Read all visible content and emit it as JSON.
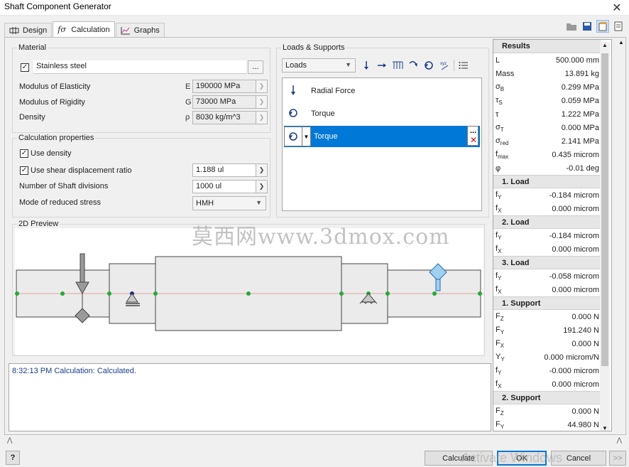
{
  "window": {
    "title": "Shaft Component Generator",
    "close": "✕"
  },
  "tabs": [
    {
      "label": "Design"
    },
    {
      "label": "Calculation"
    },
    {
      "label": "Graphs"
    }
  ],
  "material": {
    "legend": "Material",
    "name": "Stainless steel",
    "browse": "...",
    "props": [
      {
        "label": "Modulus of Elasticity",
        "sym": "E",
        "value": "190000 MPa"
      },
      {
        "label": "Modulus of Rigidity",
        "sym": "G",
        "value": "73000 MPa"
      },
      {
        "label": "Density",
        "sym": "ρ",
        "value": "8030 kg/m^3"
      }
    ]
  },
  "calc": {
    "legend": "Calculation properties",
    "use_density": "Use density",
    "use_shear": "Use shear displacement ratio",
    "shear_value": "1.188 ul",
    "divisions_label": "Number of Shaft divisions",
    "divisions_value": "1000 ul",
    "mode_label": "Mode of reduced stress",
    "mode_value": "HMH"
  },
  "loads": {
    "legend": "Loads & Supports",
    "combo": "Loads",
    "items": [
      {
        "label": "Radial Force"
      },
      {
        "label": "Torque"
      },
      {
        "label": "Torque"
      }
    ],
    "more": "..."
  },
  "preview": {
    "legend": "2D Preview"
  },
  "log": {
    "text": "8:32:13 PM Calculation: Calculated."
  },
  "results": {
    "header": "Results",
    "main": [
      {
        "n": "L",
        "v": "500.000 mm"
      },
      {
        "n": "Mass",
        "v": "13.891 kg"
      },
      {
        "n": "σB",
        "v": "0.299 MPa"
      },
      {
        "n": "τS",
        "v": "0.059 MPa"
      },
      {
        "n": "τ",
        "v": "1.222 MPa"
      },
      {
        "n": "σT",
        "v": "0.000 MPa"
      },
      {
        "n": "σred",
        "v": "2.141 MPa"
      },
      {
        "n": "fmax",
        "v": "0.435 microm"
      },
      {
        "n": "φ",
        "v": "-0.01 deg"
      }
    ],
    "load1": {
      "head": "1. Load",
      "rows": [
        {
          "n": "fY",
          "v": "-0.184 microm"
        },
        {
          "n": "fX",
          "v": "0.000 microm"
        }
      ]
    },
    "load2": {
      "head": "2. Load",
      "rows": [
        {
          "n": "fY",
          "v": "-0.184 microm"
        },
        {
          "n": "fX",
          "v": "0.000 microm"
        }
      ]
    },
    "load3": {
      "head": "3. Load",
      "rows": [
        {
          "n": "fY",
          "v": "-0.058 microm"
        },
        {
          "n": "fX",
          "v": "0.000 microm"
        }
      ]
    },
    "support1": {
      "head": "1. Support",
      "rows": [
        {
          "n": "FZ",
          "v": "0.000 N"
        },
        {
          "n": "FY",
          "v": "191.240 N"
        },
        {
          "n": "FX",
          "v": "0.000 N"
        },
        {
          "n": "YY",
          "v": "0.000 microm/N"
        },
        {
          "n": "fY",
          "v": "-0.000 microm"
        },
        {
          "n": "fX",
          "v": "0.000 microm"
        }
      ]
    },
    "support2": {
      "head": "2. Support",
      "rows": [
        {
          "n": "FZ",
          "v": "0.000 N"
        },
        {
          "n": "FY",
          "v": "44.980 N"
        }
      ]
    }
  },
  "footer": {
    "help": "?",
    "calculate": "Calculate",
    "ok": "OK",
    "cancel": "Cancel",
    "expand": ">>"
  },
  "watermark": "莫西网www.3dmox.com",
  "activate": "Activate Windows"
}
